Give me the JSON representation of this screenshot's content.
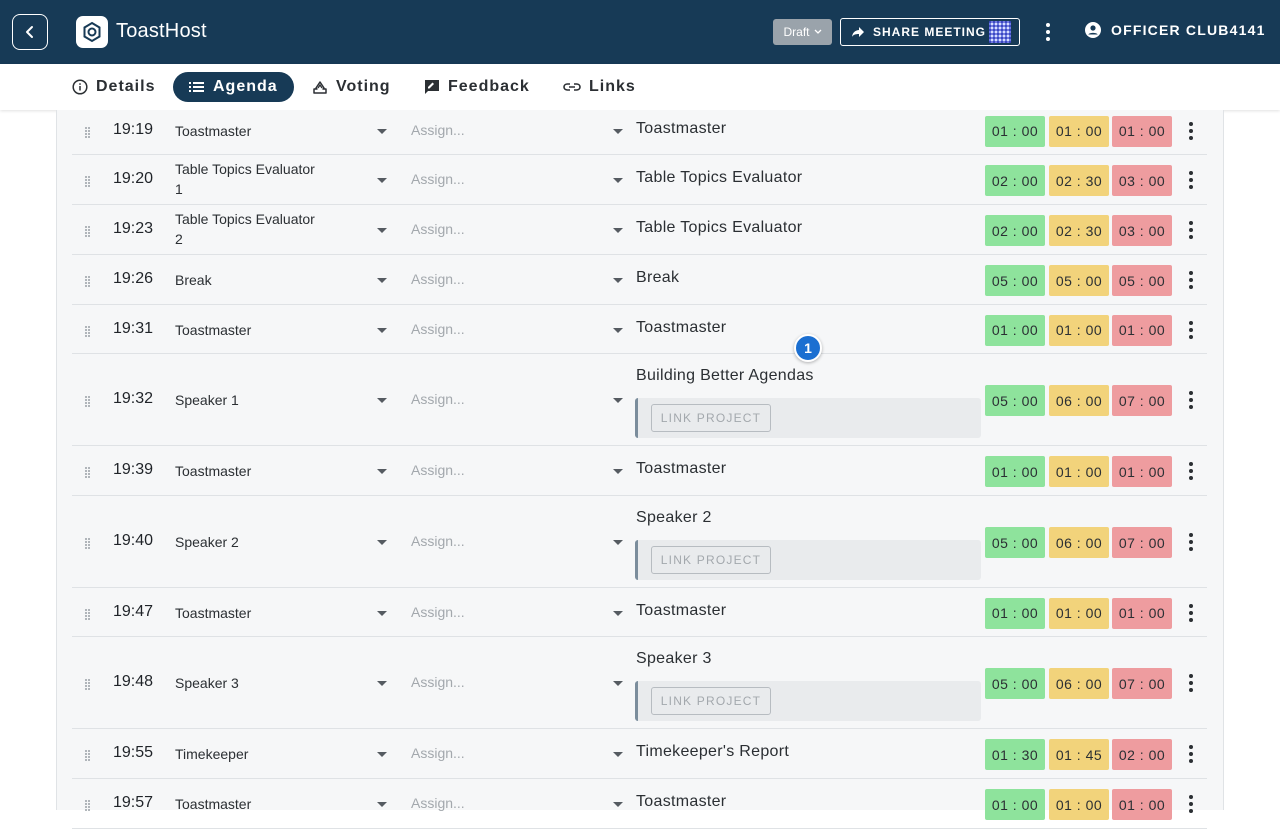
{
  "app": {
    "title": "ToastHost"
  },
  "header": {
    "status": "Draft",
    "share_label": "SHARE MEETING",
    "user_label": "OFFICER CLUB4141"
  },
  "tabs": [
    {
      "label": "Details",
      "icon": "info-icon",
      "active": false
    },
    {
      "label": "Agenda",
      "icon": "list-icon",
      "active": true
    },
    {
      "label": "Voting",
      "icon": "ballot-icon",
      "active": false
    },
    {
      "label": "Feedback",
      "icon": "feedback-icon",
      "active": false
    },
    {
      "label": "Links",
      "icon": "link-icon",
      "active": false
    }
  ],
  "assign_placeholder": "Assign...",
  "link_project_label": "LINK PROJECT",
  "badge": "1",
  "colors": {
    "green": "#8ee39c",
    "yellow": "#f2d37b",
    "red": "#ee9c9f",
    "primary": "#173a56"
  },
  "agenda": [
    {
      "time": "19:19",
      "role": "Toastmaster",
      "title": "Toastmaster",
      "green": "01 : 00",
      "yellow": "01 : 00",
      "red": "01 : 00"
    },
    {
      "time": "19:20",
      "role": "Table Topics Evaluator 1",
      "title": "Table Topics Evaluator",
      "green": "02 : 00",
      "yellow": "02 : 30",
      "red": "03 : 00"
    },
    {
      "time": "19:23",
      "role": "Table Topics Evaluator 2",
      "title": "Table Topics Evaluator",
      "green": "02 : 00",
      "yellow": "02 : 30",
      "red": "03 : 00"
    },
    {
      "time": "19:26",
      "role": "Break",
      "title": "Break",
      "green": "05 : 00",
      "yellow": "05 : 00",
      "red": "05 : 00"
    },
    {
      "time": "19:31",
      "role": "Toastmaster",
      "title": "Toastmaster",
      "green": "01 : 00",
      "yellow": "01 : 00",
      "red": "01 : 00"
    },
    {
      "time": "19:32",
      "role": "Speaker 1",
      "title": "Building Better Agendas",
      "project": true,
      "green": "05 : 00",
      "yellow": "06 : 00",
      "red": "07 : 00"
    },
    {
      "time": "19:39",
      "role": "Toastmaster",
      "title": "Toastmaster",
      "green": "01 : 00",
      "yellow": "01 : 00",
      "red": "01 : 00"
    },
    {
      "time": "19:40",
      "role": "Speaker 2",
      "title": "Speaker 2",
      "project": true,
      "green": "05 : 00",
      "yellow": "06 : 00",
      "red": "07 : 00"
    },
    {
      "time": "19:47",
      "role": "Toastmaster",
      "title": "Toastmaster",
      "green": "01 : 00",
      "yellow": "01 : 00",
      "red": "01 : 00"
    },
    {
      "time": "19:48",
      "role": "Speaker 3",
      "title": "Speaker 3",
      "project": true,
      "green": "05 : 00",
      "yellow": "06 : 00",
      "red": "07 : 00"
    },
    {
      "time": "19:55",
      "role": "Timekeeper",
      "title": "Timekeeper's Report",
      "green": "01 : 30",
      "yellow": "01 : 45",
      "red": "02 : 00"
    },
    {
      "time": "19:57",
      "role": "Toastmaster",
      "title": "Toastmaster",
      "green": "01 : 00",
      "yellow": "01 : 00",
      "red": "01 : 00"
    }
  ]
}
